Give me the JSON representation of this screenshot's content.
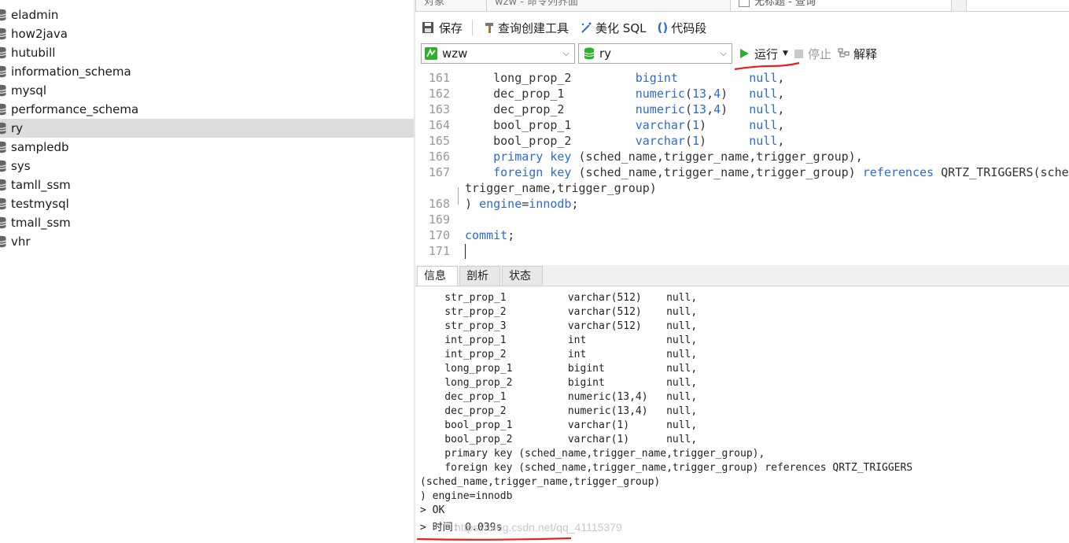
{
  "left_tree": {
    "databases": [
      {
        "name": "eladmin",
        "selected": false
      },
      {
        "name": "how2java",
        "selected": false
      },
      {
        "name": "hutubill",
        "selected": false
      },
      {
        "name": "information_schema",
        "selected": false
      },
      {
        "name": "mysql",
        "selected": false
      },
      {
        "name": "performance_schema",
        "selected": false
      },
      {
        "name": "ry",
        "selected": true
      },
      {
        "name": "sampledb",
        "selected": false
      },
      {
        "name": "sys",
        "selected": false
      },
      {
        "name": "tamll_ssm",
        "selected": false
      },
      {
        "name": "testmysql",
        "selected": false
      },
      {
        "name": "tmall_ssm",
        "selected": false
      },
      {
        "name": "vhr",
        "selected": false
      }
    ],
    "icon": "database-icon"
  },
  "tabs": [
    "对象",
    "wzw - 命令列界面",
    "无标题 - 查询"
  ],
  "toolbar": {
    "save_label": "保存",
    "query_builder_label": "查询创建工具",
    "beautify_label": "美化 SQL",
    "snippet_label": "代码段"
  },
  "selectors": {
    "connection": "wzw",
    "database": "ry",
    "run_label": "运行",
    "stop_label": "停止",
    "explain_label": "解释"
  },
  "editor": {
    "lines": [
      {
        "num": "161",
        "parts": [
          [
            "    long_prop_2         ",
            ""
          ],
          [
            "bigint",
            "kw"
          ],
          [
            "          ",
            ""
          ],
          [
            "null",
            "kw"
          ],
          [
            ",",
            ""
          ]
        ]
      },
      {
        "num": "162",
        "parts": [
          [
            "    dec_prop_1          ",
            ""
          ],
          [
            "numeric",
            "kw"
          ],
          [
            "(",
            ""
          ],
          [
            "13",
            "kw"
          ],
          [
            ",",
            ""
          ],
          [
            "4",
            "kw"
          ],
          [
            ")   ",
            ""
          ],
          [
            "null",
            "kw"
          ],
          [
            ",",
            ""
          ]
        ]
      },
      {
        "num": "163",
        "parts": [
          [
            "    dec_prop_2          ",
            ""
          ],
          [
            "numeric",
            "kw"
          ],
          [
            "(",
            ""
          ],
          [
            "13",
            "kw"
          ],
          [
            ",",
            ""
          ],
          [
            "4",
            "kw"
          ],
          [
            ")   ",
            ""
          ],
          [
            "null",
            "kw"
          ],
          [
            ",",
            ""
          ]
        ]
      },
      {
        "num": "164",
        "parts": [
          [
            "    bool_prop_1         ",
            ""
          ],
          [
            "varchar",
            "kw"
          ],
          [
            "(",
            ""
          ],
          [
            "1",
            "kw"
          ],
          [
            ")      ",
            ""
          ],
          [
            "null",
            "kw"
          ],
          [
            ",",
            ""
          ]
        ]
      },
      {
        "num": "165",
        "parts": [
          [
            "    bool_prop_2         ",
            ""
          ],
          [
            "varchar",
            "kw"
          ],
          [
            "(",
            ""
          ],
          [
            "1",
            "kw"
          ],
          [
            ")      ",
            ""
          ],
          [
            "null",
            "kw"
          ],
          [
            ",",
            ""
          ]
        ]
      },
      {
        "num": "166",
        "parts": [
          [
            "    ",
            ""
          ],
          [
            "primary key",
            "kw"
          ],
          [
            " (sched_name,trigger_name,trigger_group),",
            ""
          ]
        ]
      },
      {
        "num": "167",
        "parts": [
          [
            "    ",
            ""
          ],
          [
            "foreign key",
            "kw"
          ],
          [
            " (sched_name,trigger_name,trigger_group) ",
            ""
          ],
          [
            "references",
            "kw"
          ],
          [
            " QRTZ_TRIGGERS(sched_name,",
            ""
          ]
        ]
      },
      {
        "num": "",
        "parts": [
          [
            "trigger_name,trigger_group)",
            ""
          ]
        ]
      },
      {
        "num": "168",
        "parts": [
          [
            ") ",
            ""
          ],
          [
            "engine",
            "kw"
          ],
          [
            "=",
            ""
          ],
          [
            "innodb",
            "kw"
          ],
          [
            ";",
            ""
          ]
        ]
      },
      {
        "num": "169",
        "parts": [
          [
            "",
            ""
          ]
        ]
      },
      {
        "num": "170",
        "parts": [
          [
            "commit",
            "kw"
          ],
          [
            ";",
            ""
          ]
        ]
      },
      {
        "num": "171",
        "parts": [
          [
            "",
            ""
          ]
        ]
      }
    ]
  },
  "result_tabs": [
    "信息",
    "剖析",
    "状态"
  ],
  "output": {
    "lines": [
      "    str_prop_1          varchar(512)    null,",
      "    str_prop_2          varchar(512)    null,",
      "    str_prop_3          varchar(512)    null,",
      "    int_prop_1          int             null,",
      "    int_prop_2          int             null,",
      "    long_prop_1         bigint          null,",
      "    long_prop_2         bigint          null,",
      "    dec_prop_1          numeric(13,4)   null,",
      "    dec_prop_2          numeric(13,4)   null,",
      "    bool_prop_1         varchar(1)      null,",
      "    bool_prop_2         varchar(1)      null,",
      "    primary key (sched_name,trigger_name,trigger_group),",
      "    foreign key (sched_name,trigger_name,trigger_group) references QRTZ_TRIGGERS",
      "(sched_name,trigger_name,trigger_group)",
      ") engine=innodb",
      "> OK",
      "> 时间: 0.039s"
    ]
  },
  "watermark": "https://blog.csdn.net/qq_41115379",
  "colors": {
    "keyword": "#2b6bd6",
    "annotation": "#e8211c",
    "run_green": "#2fae2f"
  }
}
